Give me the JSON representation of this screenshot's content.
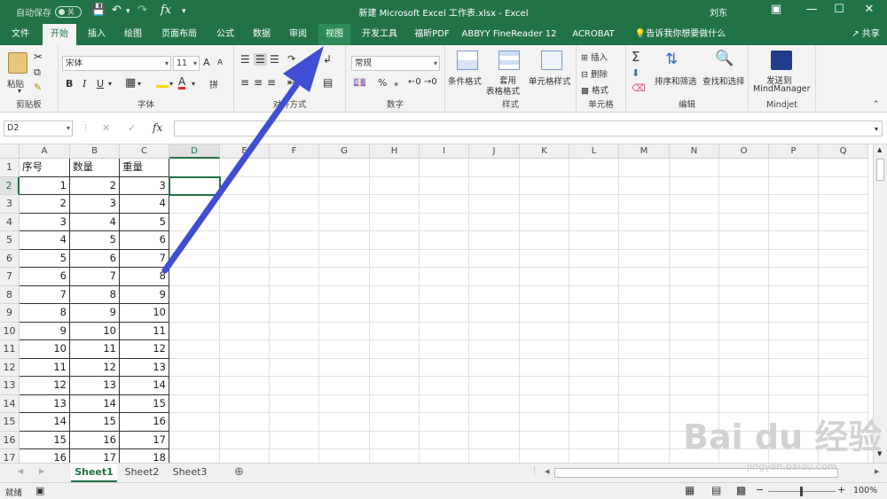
{
  "titlebar": {
    "autosave_label": "自动保存",
    "autosave_state": "关",
    "title": "新建 Microsoft Excel 工作表.xlsx  -  Excel",
    "user": "刘东"
  },
  "tabs": [
    "文件",
    "开始",
    "插入",
    "绘图",
    "页面布局",
    "公式",
    "数据",
    "审阅",
    "视图",
    "开发工具",
    "福昕PDF",
    "ABBYY FineReader 12",
    "ACROBAT"
  ],
  "tell_me": "告诉我你想要做什么",
  "share": "共享",
  "ribbon": {
    "clipboard": {
      "paste": "粘贴",
      "label": "剪贴板"
    },
    "font": {
      "name": "宋体",
      "size": "11",
      "label": "字体",
      "bold": "B",
      "italic": "I",
      "underline": "U",
      "grow": "A",
      "shrink": "A"
    },
    "alignment": {
      "label": "对齐方式"
    },
    "number": {
      "format": "常规",
      "label": "数字",
      "percent": "%"
    },
    "styles": {
      "conditional": "条件格式",
      "table_line1": "套用",
      "table_line2": "表格格式",
      "cell_styles": "单元格样式",
      "label": "样式"
    },
    "cells": {
      "insert": "插入",
      "delete": "删除",
      "format": "格式",
      "label": "单元格"
    },
    "editing": {
      "sort": "排序和筛选",
      "find": "查找和选择",
      "label": "编辑"
    },
    "mindjet": {
      "line1": "发送到",
      "line2": "MindManager",
      "label": "Mindjet"
    }
  },
  "formula_bar": {
    "name_box": "D2",
    "fx": "fx",
    "value": ""
  },
  "columns": [
    "A",
    "B",
    "C",
    "D",
    "E",
    "F",
    "G",
    "H",
    "I",
    "J",
    "K",
    "L",
    "M",
    "N",
    "O",
    "P",
    "Q"
  ],
  "rows": [
    "1",
    "2",
    "3",
    "4",
    "5",
    "6",
    "7",
    "8",
    "9",
    "10",
    "11",
    "12",
    "13",
    "14",
    "15",
    "16",
    "17"
  ],
  "header_row": [
    "序号",
    "数量",
    "重量"
  ],
  "data_rows": [
    [
      "1",
      "2",
      "3"
    ],
    [
      "2",
      "3",
      "4"
    ],
    [
      "3",
      "4",
      "5"
    ],
    [
      "4",
      "5",
      "6"
    ],
    [
      "5",
      "6",
      "7"
    ],
    [
      "6",
      "7",
      "8"
    ],
    [
      "7",
      "8",
      "9"
    ],
    [
      "8",
      "9",
      "10"
    ],
    [
      "9",
      "10",
      "11"
    ],
    [
      "10",
      "11",
      "12"
    ],
    [
      "11",
      "12",
      "13"
    ],
    [
      "12",
      "13",
      "14"
    ],
    [
      "13",
      "14",
      "15"
    ],
    [
      "14",
      "15",
      "16"
    ],
    [
      "15",
      "16",
      "17"
    ],
    [
      "16",
      "17",
      "18"
    ]
  ],
  "sheets": [
    "Sheet1",
    "Sheet2",
    "Sheet3"
  ],
  "status": {
    "ready": "就绪",
    "zoom": "100%"
  },
  "watermark": {
    "brand": "Bai du 经验",
    "url": "jingyan.baidu.com"
  }
}
